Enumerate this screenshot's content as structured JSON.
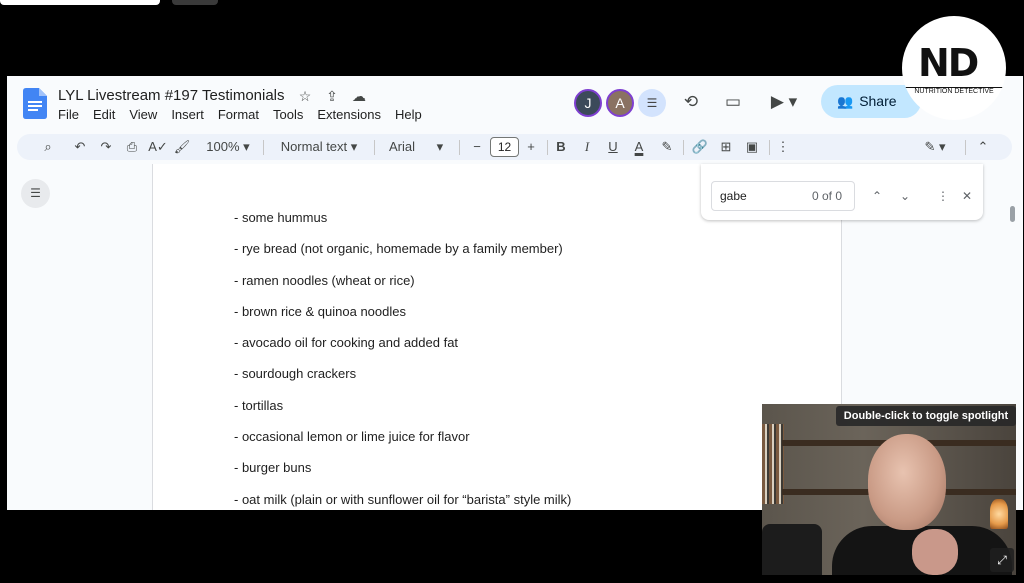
{
  "doc": {
    "title": "LYL Livestream #197 Testimonials",
    "menu": [
      "File",
      "Edit",
      "View",
      "Insert",
      "Format",
      "Tools",
      "Extensions",
      "Help"
    ],
    "share_label": "Share",
    "avatars": [
      "J",
      "A"
    ]
  },
  "toolbar": {
    "zoom": "100%",
    "style": "Normal text",
    "font": "Arial",
    "font_size": "12",
    "bold": "B",
    "italic": "I",
    "underline": "U",
    "text_color": "A"
  },
  "find": {
    "query": "gabe",
    "count": "0 of 0"
  },
  "content": {
    "lines": [
      "- some hummus",
      "- rye bread (not organic, homemade by a family member)",
      "- ramen noodles (wheat or rice)",
      "- brown rice & quinoa noodles",
      "- avocado oil for cooking and added fat",
      "- sourdough crackers",
      "- tortillas",
      "- occasional lemon or lime juice for flavor",
      "- burger buns",
      "- oat milk (plain or with sunflower oil for “barista” style milk)"
    ]
  },
  "logo": {
    "mark": "ND",
    "text": "NUTRITION DETECTIVE"
  },
  "webcam": {
    "tooltip": "Double-click to toggle spotlight"
  },
  "colors": {
    "share_bg": "#c2e7ff",
    "toolbar_bg": "#edf2fa",
    "page_bg": "#f9fbfd"
  }
}
